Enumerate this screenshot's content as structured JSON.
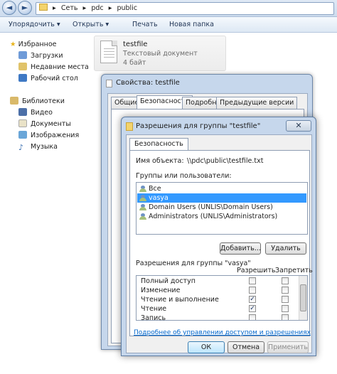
{
  "address": {
    "back_arrow": "◄",
    "forward_arrow": "►",
    "sep": "▸",
    "path": [
      "Сеть",
      "pdc",
      "public"
    ]
  },
  "toolbar": {
    "organize": "Упорядочить ▾",
    "open": "Открыть ▾",
    "print": "Печать",
    "new_folder": "Новая папка"
  },
  "sidebar": {
    "favorites": "Избранное",
    "fav_items": [
      "Загрузки",
      "Недавние места",
      "Рабочий стол"
    ],
    "libraries": "Библиотеки",
    "lib_items": [
      "Видео",
      "Документы",
      "Изображения",
      "Музыка"
    ]
  },
  "file": {
    "name": "testfile",
    "type": "Текстовый документ",
    "size": "4 байт"
  },
  "properties": {
    "title": "Свойства: testfile",
    "tabs": [
      "Общие",
      "Безопасность",
      "Подробно",
      "Предыдущие версии"
    ],
    "selected_tab": "Безопасность"
  },
  "permissions": {
    "title": "Разрешения для группы \"testfile\"",
    "close": "✕",
    "tab": "Безопасность",
    "object_label": "Имя объекта:",
    "object_value": "\\\\pdc\\public\\testfile.txt",
    "groups_label": "Группы или пользователи:",
    "users": [
      {
        "name": "Все",
        "selected": false
      },
      {
        "name": "vasya",
        "selected": true
      },
      {
        "name": "Domain Users (UNLIS\\Domain Users)",
        "selected": false
      },
      {
        "name": "Administrators (UNLIS\\Administrators)",
        "selected": false
      }
    ],
    "add_button": "Добавить...",
    "remove_button": "Удалить",
    "perm_label": "Разрешения для группы \"vasya\"",
    "allow_header": "Разрешить",
    "deny_header": "Запретить",
    "rows": [
      {
        "name": "Полный доступ",
        "allow": false,
        "deny": false
      },
      {
        "name": "Изменение",
        "allow": false,
        "deny": false
      },
      {
        "name": "Чтение и выполнение",
        "allow": true,
        "deny": false
      },
      {
        "name": "Чтение",
        "allow": true,
        "deny": false
      },
      {
        "name": "Запись",
        "allow": false,
        "deny": false
      }
    ],
    "help_link": "Подробнее об управлении доступом и разрешениях",
    "ok": "ОК",
    "cancel": "Отмена",
    "apply": "Применить"
  },
  "colors": {
    "selection": "#3399ff",
    "link": "#0066cc",
    "window_frame": "#c6d7ec"
  }
}
